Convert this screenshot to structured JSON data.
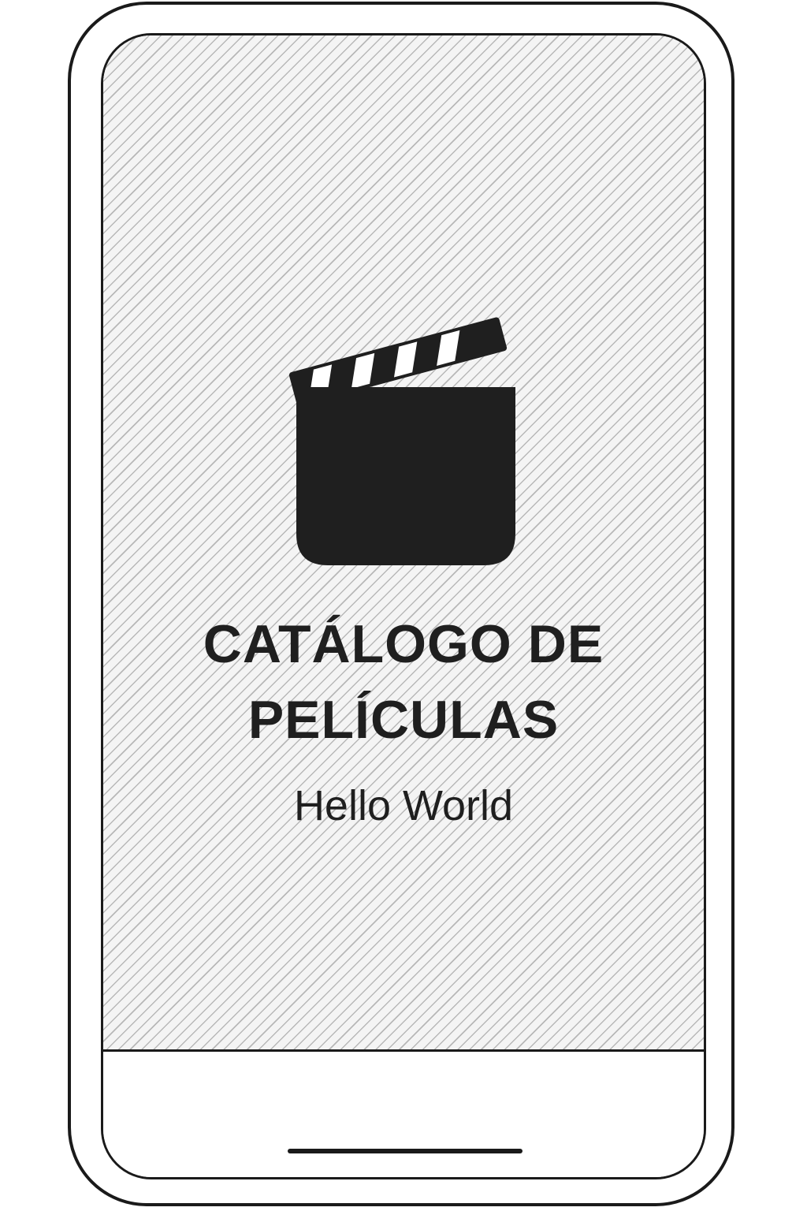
{
  "app": {
    "title_line_1": "CATÁLOGO DE",
    "title_line_2": "PELÍCULAS",
    "subtitle": "Hello World",
    "logo_icon": "clapperboard-icon"
  },
  "colors": {
    "text": "#1f1f1f",
    "frame": "#1a1a1a",
    "pattern_stripe": "#b8b8b8",
    "pattern_bg": "#f4f4f4"
  }
}
